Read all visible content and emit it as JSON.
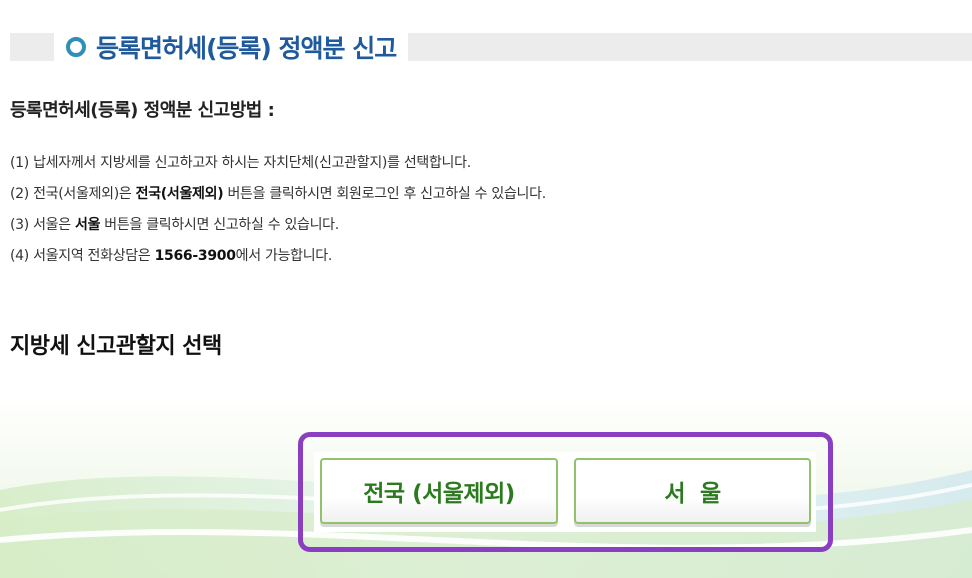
{
  "header": {
    "title": "등록면허세(등록) 정액분 신고"
  },
  "method": {
    "heading": "등록면허세(등록) 정액분 신고방법 :",
    "steps": [
      {
        "prefix": "(1) 납세자께서 지방세를 신고하고자 하시는 자치단체(신고관할지)를 선택합니다.",
        "bold": "",
        "suffix": ""
      },
      {
        "prefix": "(2) 전국(서울제외)은 ",
        "bold": "전국(서울제외)",
        "suffix": " 버튼을 클릭하시면 회원로그인 후 신고하실 수 있습니다."
      },
      {
        "prefix": "(3) 서울은 ",
        "bold": "서울",
        "suffix": " 버튼을 클릭하시면 신고하실 수 있습니다."
      },
      {
        "prefix": "(4) 서울지역 전화상담은 ",
        "bold": "1566-3900",
        "suffix": "에서 가능합니다."
      }
    ]
  },
  "select": {
    "heading": "지방세 신고관할지 선택",
    "national_button": "전국 (서울제외)",
    "seoul_button": "서  울"
  },
  "colors": {
    "title": "#1e5a9c",
    "button_text": "#2b7a1e",
    "button_border": "#8fc36a",
    "highlight": "#8a3fc2"
  }
}
